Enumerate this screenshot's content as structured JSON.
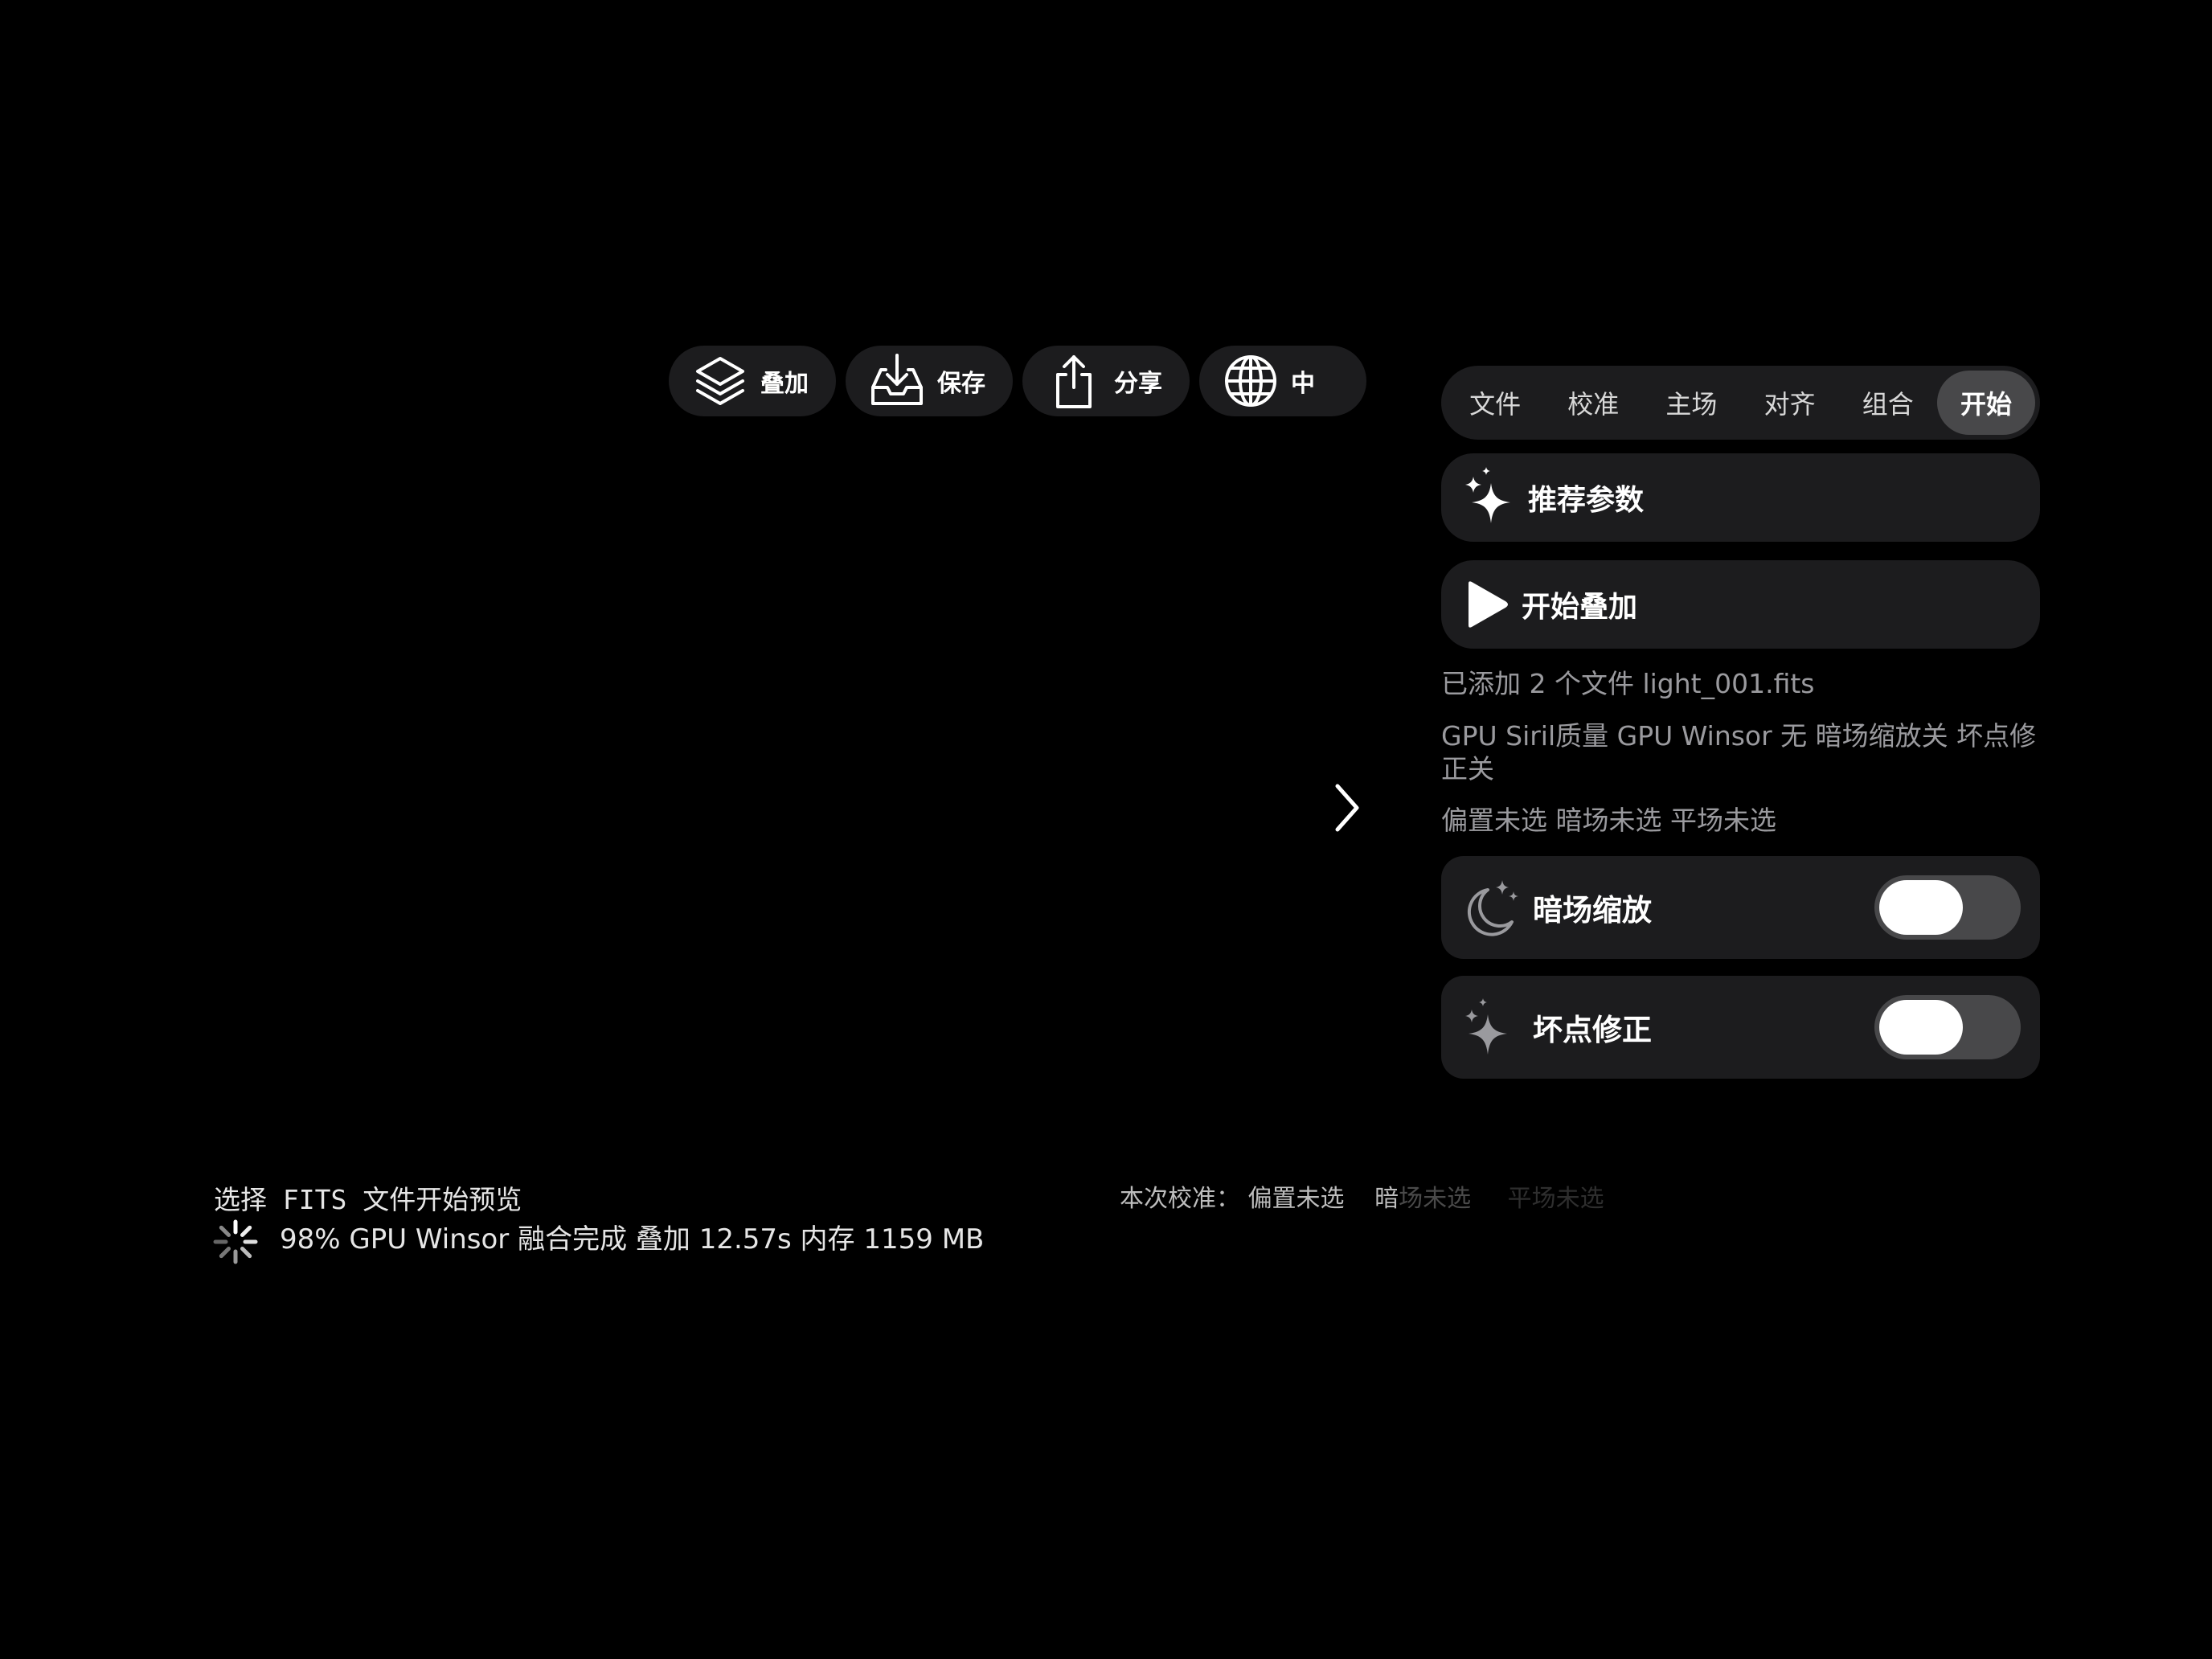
{
  "toolbar": {
    "stack_label": "叠加",
    "save_label": "保存",
    "share_label": "分享",
    "language_label": "中"
  },
  "tabs": [
    {
      "label": "文件",
      "active": false
    },
    {
      "label": "校准",
      "active": false
    },
    {
      "label": "主场",
      "active": false
    },
    {
      "label": "对齐",
      "active": false
    },
    {
      "label": "组合",
      "active": false
    },
    {
      "label": "开始",
      "active": true
    }
  ],
  "panel": {
    "recommend_label": "推荐参数",
    "start_label": "开始叠加",
    "files_info": "已添加 2 个文件  light_001.fits",
    "method_info": "GPU Siril质量  GPU Winsor  无  暗场缩放关  坏点修正关",
    "calib_info": "偏置未选  暗场未选  平场未选",
    "dark_scaling_label": "暗场缩放",
    "dark_scaling_on": false,
    "hot_pixel_label": "坏点修正",
    "hot_pixel_on": false
  },
  "status": {
    "preview_hint": "选择 FITS 文件开始预览",
    "progress_text": "98% GPU Winsor 融合完成  叠加 12.57s  内存 1159 MB",
    "progress_percent": 98,
    "calib_prefix": "本次校准：",
    "calib_bias": "偏置未选",
    "calib_dark_a": "暗",
    "calib_dark_b": "场未选",
    "calib_flat": "平场未选"
  },
  "colors": {
    "background": "#000000",
    "panel": "#1c1c1e",
    "active_tab": "#48484a",
    "secondary_text": "#9a9a9e"
  },
  "icons": [
    "layers-icon",
    "tray-download-icon",
    "share-icon",
    "globe-icon",
    "sparkles-icon",
    "play-icon",
    "moon-stars-icon",
    "sparkle-icon",
    "chevron-right-icon",
    "spinner-icon"
  ]
}
